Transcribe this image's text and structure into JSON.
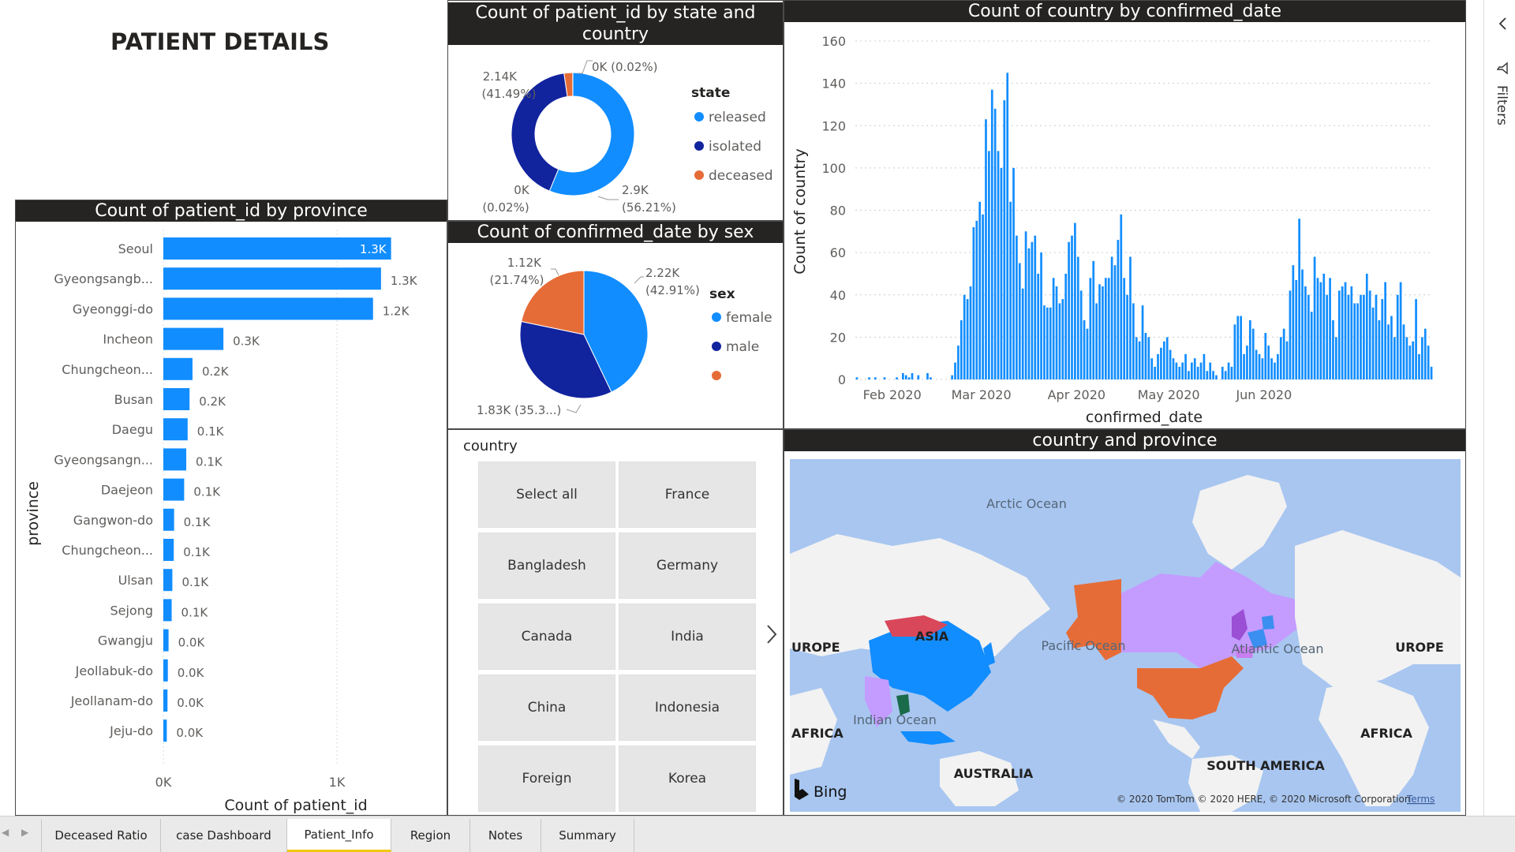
{
  "page": {
    "title": "PATIENT DETAILS"
  },
  "colors": {
    "blue": "#118dff",
    "navy": "#12239e",
    "orange": "#e66c37",
    "header": "#252423"
  },
  "donut": {
    "title": "Count of patient_id by state and country",
    "legend_title": "state",
    "legend": [
      "released",
      "isolated",
      "deceased"
    ],
    "labels": {
      "top": "0K (0.02%)",
      "left_value": "2.14K",
      "left_pct": "(41.49%)",
      "bottom_value": "0K",
      "bottom_pct": "(0.02%)",
      "right_value": "2.9K",
      "right_pct": "(56.21%)"
    }
  },
  "pie": {
    "title": "Count of confirmed_date by sex",
    "legend_title": "sex",
    "legend": [
      "female",
      "male",
      ""
    ],
    "labels": {
      "left_value": "1.12K",
      "left_pct": "(21.74%)",
      "right_value": "2.22K",
      "right_pct": "(42.91%)",
      "bottom": "1.83K (35.3...)"
    }
  },
  "province_chart": {
    "title": "Count of patient_id by province",
    "xlabel": "Count of patient_id",
    "ylabel": "province"
  },
  "time_chart": {
    "title": "Count of country by confirmed_date",
    "xlabel": "confirmed_date",
    "ylabel": "Count of country"
  },
  "slicer": {
    "title": "country",
    "items": [
      "Select all",
      "France",
      "Bangladesh",
      "Germany",
      "Canada",
      "India",
      "China",
      "Indonesia",
      "Foreign",
      "Korea"
    ]
  },
  "map": {
    "title": "country and province",
    "labels": {
      "arctic": "Arctic Ocean",
      "pacific": "Pacific Ocean",
      "atlantic": "Atlantic Ocean",
      "indian": "Indian Ocean",
      "asia": "ASIA",
      "europe_left": "UROPE",
      "europe_right": "UROPE",
      "africa_left": "AFRICA",
      "africa_right": "AFRICA",
      "australia": "AUSTRALIA",
      "south_america": "SOUTH AMERICA"
    },
    "bing": "Bing",
    "copyright": "© 2020 TomTom © 2020 HERE, © 2020 Microsoft Corporation",
    "terms": "Terms"
  },
  "filters_label": "Filters",
  "tabs": [
    "Deceased Ratio",
    "case Dashboard",
    "Patient_Info",
    "Region",
    "Notes",
    "Summary"
  ],
  "active_tab": "Patient_Info",
  "chart_data": [
    {
      "type": "bar",
      "title": "Count of patient_id by province",
      "xlabel": "Count of patient_id",
      "ylabel": "province",
      "orientation": "horizontal",
      "categories": [
        "Seoul",
        "Gyeongsangb...",
        "Gyeonggi-do",
        "Incheon",
        "Chungcheon...",
        "Busan",
        "Daegu",
        "Gyeongsangn...",
        "Daejeon",
        "Gangwon-do",
        "Chungcheon...",
        "Ulsan",
        "Sejong",
        "Gwangju",
        "Jeollabuk-do",
        "Jeollanam-do",
        "Jeju-do"
      ],
      "values": [
        1312,
        1254,
        1208,
        346,
        168,
        151,
        140,
        132,
        120,
        62,
        60,
        52,
        48,
        30,
        26,
        24,
        20
      ],
      "data_labels": [
        "1.3K",
        "1.3K",
        "1.2K",
        "0.3K",
        "0.2K",
        "0.2K",
        "0.1K",
        "0.1K",
        "0.1K",
        "0.1K",
        "0.1K",
        "0.1K",
        "0.1K",
        "0.0K",
        "0.0K",
        "0.0K",
        "0.0K"
      ],
      "xticks": [
        "0K",
        "1K"
      ],
      "xlim": [
        0,
        1500
      ],
      "color": "#118dff"
    },
    {
      "type": "pie",
      "title": "Count of patient_id by state and country",
      "donut": true,
      "legend_title": "state",
      "series": [
        {
          "name": "released",
          "value": 56.21,
          "color": "#118dff"
        },
        {
          "name": "isolated",
          "value": 41.49,
          "color": "#12239e"
        },
        {
          "name": "deceased",
          "value": 2.28,
          "color": "#e66c37"
        },
        {
          "name": "",
          "value": 0.02,
          "color": "#6b007b"
        }
      ]
    },
    {
      "type": "pie",
      "title": "Count of confirmed_date by sex",
      "legend_title": "sex",
      "series": [
        {
          "name": "female",
          "value": 42.91,
          "color": "#118dff"
        },
        {
          "name": "male",
          "value": 35.35,
          "color": "#12239e"
        },
        {
          "name": "",
          "value": 21.74,
          "color": "#e66c37"
        }
      ]
    },
    {
      "type": "bar",
      "title": "Count of country by confirmed_date",
      "xlabel": "confirmed_date",
      "ylabel": "Count of country",
      "ylim": [
        0,
        160
      ],
      "yticks": [
        0,
        20,
        40,
        60,
        80,
        100,
        120,
        140,
        160
      ],
      "xticks": [
        "Feb 2020",
        "Mar 2020",
        "Apr 2020",
        "May 2020",
        "Jun 2020"
      ],
      "x_start": "2020-01-20",
      "values": [
        1,
        0,
        0,
        0,
        1,
        0,
        1,
        0,
        0,
        1,
        0,
        0,
        0,
        1,
        0,
        3,
        2,
        1,
        3,
        0,
        2,
        0,
        0,
        3,
        1,
        0,
        0,
        0,
        0,
        0,
        0,
        2,
        8,
        16,
        28,
        40,
        38,
        44,
        72,
        75,
        84,
        78,
        123,
        108,
        137,
        128,
        108,
        100,
        132,
        145,
        84,
        100,
        68,
        55,
        43,
        70,
        62,
        65,
        68,
        50,
        60,
        35,
        34,
        34,
        48,
        44,
        36,
        38,
        50,
        65,
        68,
        74,
        58,
        42,
        28,
        24,
        48,
        56,
        36,
        45,
        44,
        48,
        48,
        58,
        54,
        66,
        78,
        48,
        40,
        58,
        36,
        20,
        18,
        35,
        22,
        20,
        10,
        6,
        12,
        15,
        18,
        20,
        14,
        10,
        8,
        6,
        8,
        12,
        4,
        8,
        10,
        6,
        8,
        12,
        4,
        8,
        4,
        2,
        0,
        6,
        4,
        8,
        6,
        26,
        30,
        30,
        12,
        16,
        28,
        24,
        14,
        12,
        10,
        22,
        16,
        10,
        8,
        12,
        20,
        24,
        18,
        42,
        54,
        47,
        76,
        52,
        44,
        40,
        32,
        58,
        48,
        46,
        50,
        40,
        48,
        28,
        20,
        42,
        44,
        46,
        40,
        44,
        36,
        36,
        40,
        40,
        50,
        42,
        34,
        40,
        28,
        38,
        46,
        26,
        30,
        20,
        40,
        46,
        26,
        20,
        16,
        18,
        38,
        12,
        20,
        24,
        16,
        6
      ]
    }
  ]
}
